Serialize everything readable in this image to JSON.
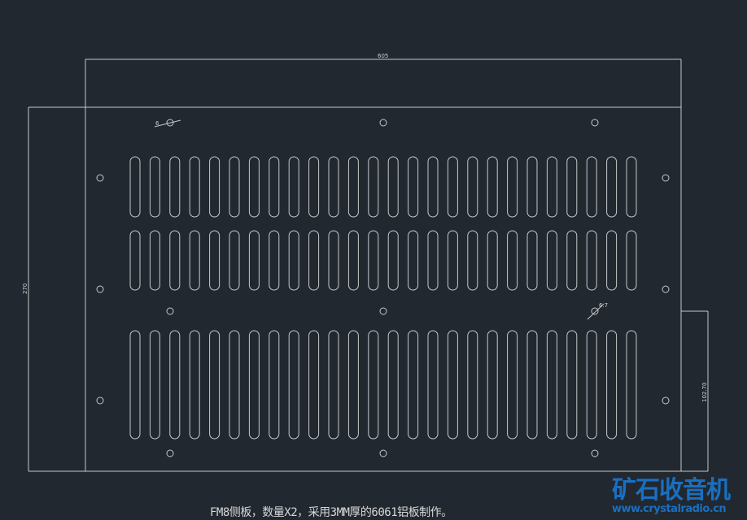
{
  "drawing": {
    "dimensions": {
      "width": "605",
      "height": "270",
      "right_offset": "102.70"
    },
    "hole_labels": {
      "top_left": "6",
      "middle_right": "6.7"
    },
    "slots": {
      "columns": 26,
      "rows": 3
    },
    "caption": "FM8侧板，数量X2，采用3MM厚的6061铝板制作。"
  },
  "watermark": {
    "title": "矿石收音机",
    "url": "www.crystalradio.cn"
  },
  "colors": {
    "background": "#212830",
    "line": "#d8d8d8",
    "logo": "#1a6fc0"
  }
}
